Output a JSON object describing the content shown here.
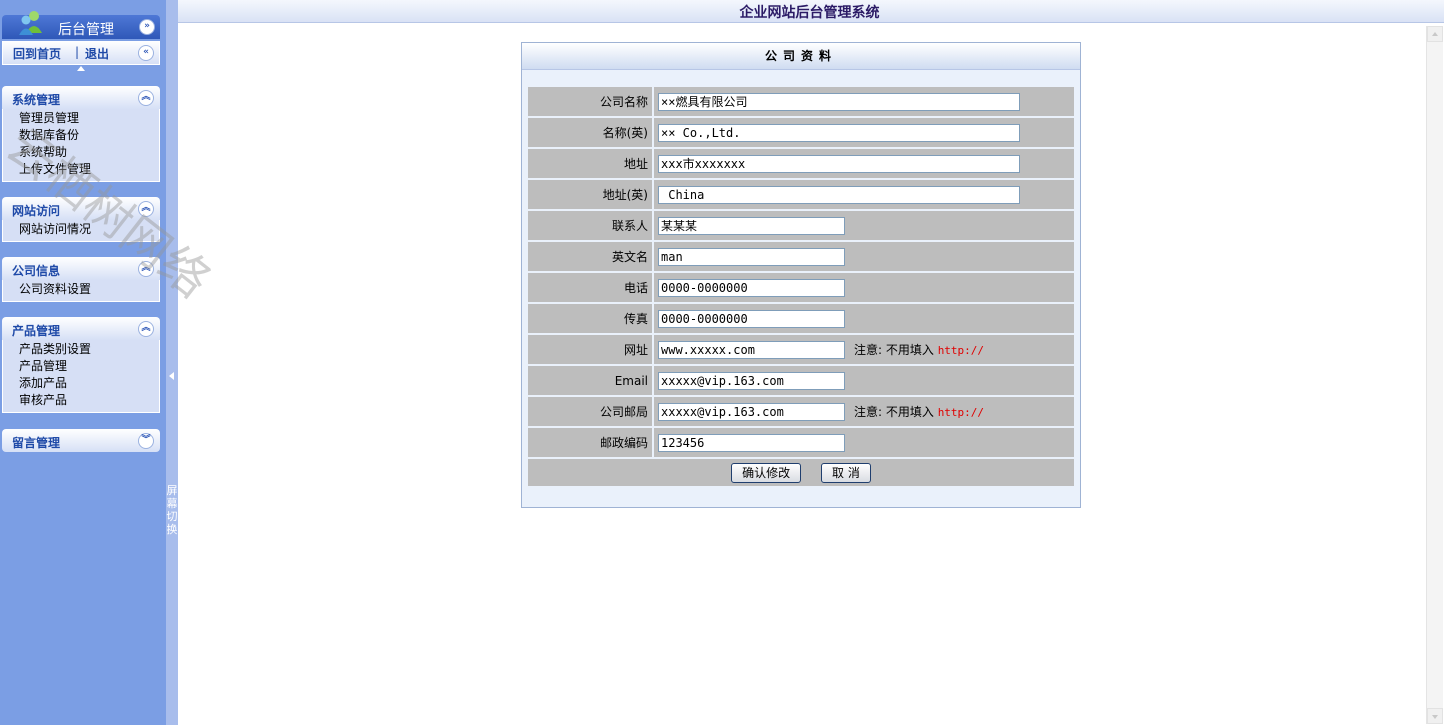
{
  "sidebar": {
    "title": "后台管理",
    "quick_links": {
      "home": "回到首页",
      "separator": "|",
      "logout": "退出"
    },
    "groups": [
      {
        "title": "系统管理",
        "items": [
          "管理员管理",
          "数据库备份",
          "系统帮助",
          "上传文件管理"
        ]
      },
      {
        "title": "网站访问",
        "items": [
          "网站访问情况"
        ]
      },
      {
        "title": "公司信息",
        "items": [
          "公司资料设置"
        ]
      },
      {
        "title": "产品管理",
        "items": [
          "产品类别设置",
          "产品管理",
          "添加产品",
          "审核产品"
        ]
      },
      {
        "title": "留言管理",
        "items": []
      }
    ]
  },
  "toggle_bar": {
    "label": "屏幕切换"
  },
  "header": {
    "system_title": "企业网站后台管理系统"
  },
  "panel": {
    "title": "公司资料",
    "fields": {
      "company_name": {
        "label": "公司名称",
        "value": "××燃具有限公司"
      },
      "company_name_en": {
        "label": "名称(英)",
        "value": "×× Co.,Ltd."
      },
      "address": {
        "label": "地址",
        "value": "xxx市xxxxxxx"
      },
      "address_en": {
        "label": "地址(英)",
        "value": " China"
      },
      "contact": {
        "label": "联系人",
        "value": "某某某"
      },
      "english_name": {
        "label": "英文名",
        "value": "man"
      },
      "phone": {
        "label": "电话",
        "value": "0000-0000000"
      },
      "fax": {
        "label": "传真",
        "value": "0000-0000000"
      },
      "website": {
        "label": "网址",
        "value": "www.xxxxx.com"
      },
      "email": {
        "label": "Email",
        "value": "xxxxx@vip.163.com"
      },
      "company_mail": {
        "label": "公司邮局",
        "value": "xxxxx@vip.163.com"
      },
      "postcode": {
        "label": "邮政编码",
        "value": "123456"
      }
    },
    "note_prefix": "注意: 不用填入",
    "note_http": "http://",
    "confirm_button": "确认修改",
    "cancel_button": "取 消"
  },
  "watermark": "云栖树网络",
  "colors": {
    "sidebar_bg": "#7b9ee4",
    "title_text": "#2b1b66",
    "row_bg": "#bdbdbd",
    "note_red": "#e00000"
  }
}
